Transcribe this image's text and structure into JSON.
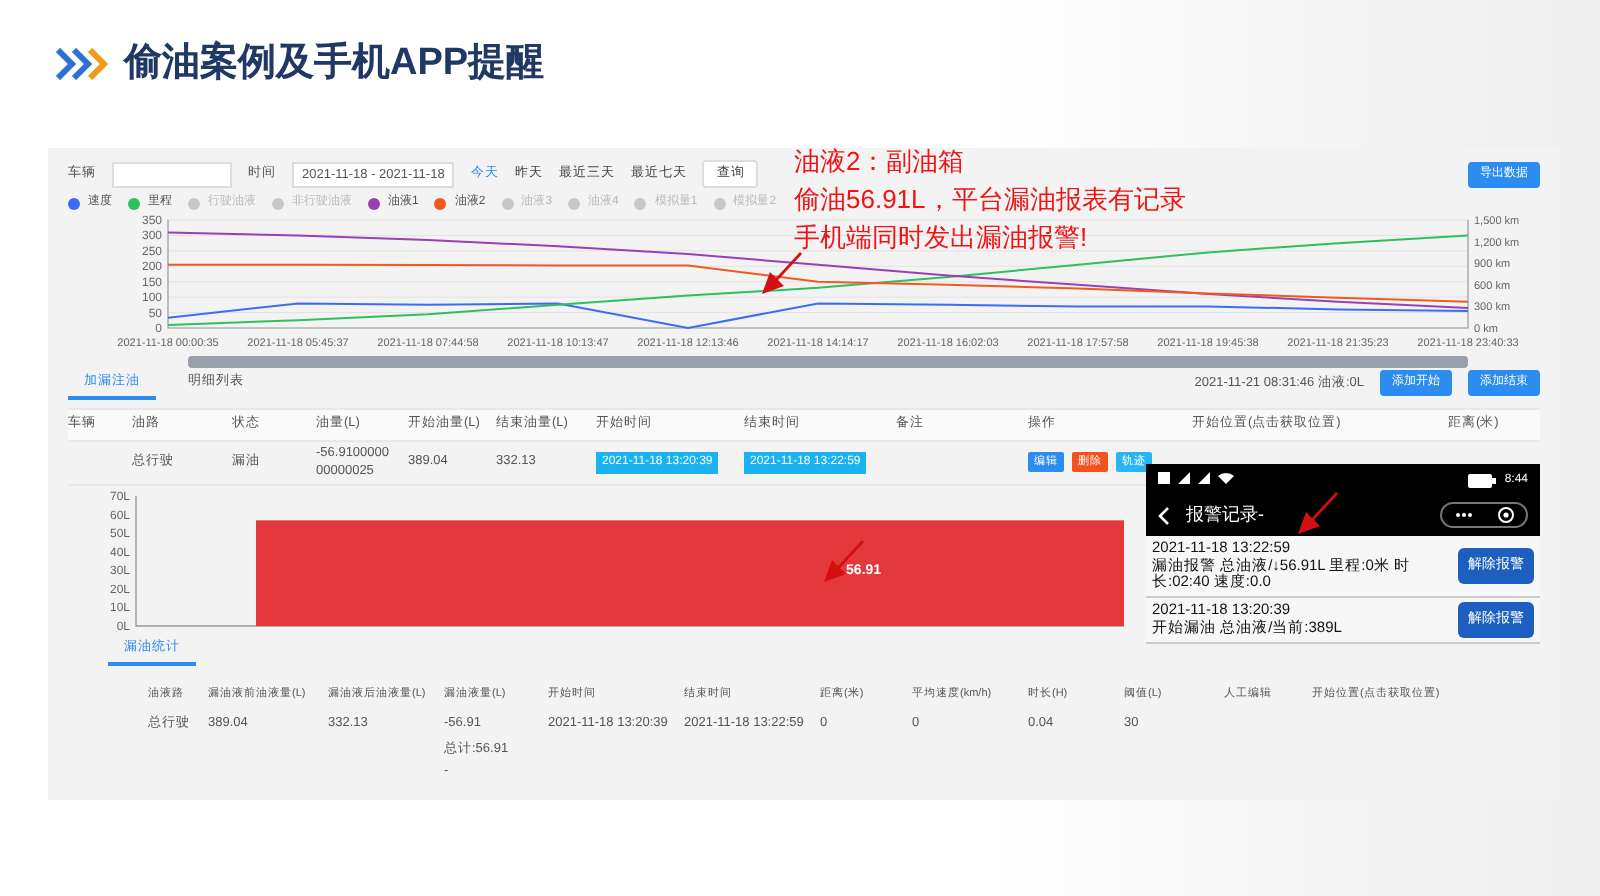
{
  "slide": {
    "title": "偷油案例及手机APP提醒"
  },
  "annotation": {
    "lines": [
      "油液2：副油箱",
      "偷油56.91L，平台漏油报表有记录",
      "手机端同时发出漏油报警!"
    ]
  },
  "filter": {
    "vehicle_label": "车辆",
    "time_label": "时间",
    "date_range": "2021-11-18 - 2021-11-18",
    "quick_ranges": [
      {
        "label": "今天",
        "selected": true
      },
      {
        "label": "昨天",
        "selected": false
      },
      {
        "label": "最近三天",
        "selected": false
      },
      {
        "label": "最近七天",
        "selected": false
      }
    ],
    "query_button": "查询",
    "export_button": "导出数据"
  },
  "legend": [
    {
      "kind": "series"
    },
    {
      "kind": "series"
    },
    {
      "kind": "inactive",
      "name": "行驶油液"
    },
    {
      "kind": "inactive",
      "name": "非行驶油液"
    },
    {
      "kind": "series"
    },
    {
      "kind": "series"
    },
    {
      "kind": "inactive",
      "name": "油液3"
    },
    {
      "kind": "inactive",
      "name": "油液4"
    },
    {
      "kind": "inactive",
      "name": "模拟量1"
    },
    {
      "kind": "inactive",
      "name": "模拟量2"
    }
  ],
  "trend_chart": {
    "right_axis_labels": [
      "1,500 km",
      "1,200 km",
      "900 km",
      "600 km",
      "300 km",
      "0 km"
    ],
    "chart_data": {
      "type": "line",
      "x": [
        "2021-11-18 00:00:35",
        "2021-11-18 05:45:37",
        "2021-11-18 07:44:58",
        "2021-11-18 10:13:47",
        "2021-11-18 12:13:46",
        "2021-11-18 14:14:17",
        "2021-11-18 16:02:03",
        "2021-11-18 17:57:58",
        "2021-11-18 19:45:38",
        "2021-11-18 21:35:23",
        "2021-11-18 23:40:33"
      ],
      "ylim": [
        0,
        350
      ],
      "yticks": [
        0,
        50,
        100,
        150,
        200,
        250,
        300,
        350
      ],
      "grid": true,
      "series": [
        {
          "name": "速度",
          "color": "#3b6cf6",
          "values": [
            33,
            80,
            75,
            80,
            0,
            80,
            75,
            70,
            70,
            60,
            55
          ]
        },
        {
          "name": "里程",
          "color": "#2fbf5f",
          "values": [
            10,
            25,
            45,
            75,
            105,
            130,
            165,
            205,
            245,
            275,
            300
          ]
        },
        {
          "name": "油液1",
          "color": "#9b3fb5",
          "values": [
            309,
            300,
            285,
            265,
            240,
            205,
            170,
            140,
            110,
            85,
            65
          ]
        },
        {
          "name": "油液2",
          "color": "#f05a1e",
          "values": [
            205,
            205,
            204,
            203,
            202,
            150,
            140,
            128,
            112,
            98,
            85
          ]
        }
      ]
    }
  },
  "tabs": [
    {
      "label": "加漏注油",
      "selected": true
    },
    {
      "label": "明细列表",
      "selected": false
    }
  ],
  "status_text": "2021-11-21 08:31:46 油液:0L",
  "action_buttons": [
    "添加开始",
    "添加结束"
  ],
  "events_table": {
    "vehicle_label": "车辆",
    "columns": [
      "油路",
      "状态",
      "油量(L)",
      "开始油量(L)",
      "结束油量(L)",
      "开始时间",
      "结束时间",
      "备注",
      "操作",
      "开始位置(点击获取位置)",
      "距离(米)"
    ],
    "rows": [
      {
        "cells": [
          "总行驶",
          "漏油",
          "-56.910000000000025",
          "389.04",
          "332.13"
        ],
        "start_time": "2021-11-18 13:20:39",
        "end_time": "2021-11-18 13:22:59",
        "actions": [
          {
            "label": "编辑",
            "kind": "edit"
          },
          {
            "label": "删除",
            "kind": "delete"
          },
          {
            "label": "轨迹",
            "kind": "track"
          }
        ]
      }
    ]
  },
  "leak_chart": {
    "chart_data": {
      "type": "bar",
      "values": [
        56.91
      ],
      "ylim": [
        0,
        70
      ],
      "yticks": [
        {
          "value": 0,
          "label": "0L"
        },
        {
          "value": 10,
          "label": "10L"
        },
        {
          "value": 20,
          "label": "20L"
        },
        {
          "value": 30,
          "label": "30L"
        },
        {
          "value": 40,
          "label": "40L"
        },
        {
          "value": 50,
          "label": "50L"
        },
        {
          "value": 60,
          "label": "60L"
        },
        {
          "value": 70,
          "label": "70L"
        }
      ],
      "data_labels": true
    }
  },
  "stats_tab": {
    "label": "漏油统计",
    "selected": true
  },
  "stats_table": {
    "columns": [
      "油液路",
      "漏油液前油液量(L)",
      "漏油液后油液量(L)",
      "漏油液量(L)",
      "开始时间",
      "结束时间",
      "距离(米)",
      "平均速度(km/h)",
      "时长(H)",
      "阈值(L)",
      "人工编辑",
      "开始位置(点击获取位置)"
    ],
    "rows": [
      [
        "总行驶",
        "389.04",
        "332.13",
        "-56.91",
        "2021-11-18 13:20:39",
        "2021-11-18 13:22:59",
        "0",
        "0",
        "0.04",
        "30"
      ]
    ],
    "total": "总计:56.91",
    "footer": "-"
  },
  "phone": {
    "time": "8:44",
    "title": "报警记录-",
    "items": [
      {
        "time": "2021-11-18 13:22:59",
        "text": "漏油报警 总油液/↓56.91L 里程:0米 时长:02:40 速度:0.0",
        "button": "解除报警"
      },
      {
        "time": "2021-11-18 13:20:39",
        "text": "开始漏油 总油液/当前:389L",
        "button": "解除报警"
      }
    ]
  }
}
